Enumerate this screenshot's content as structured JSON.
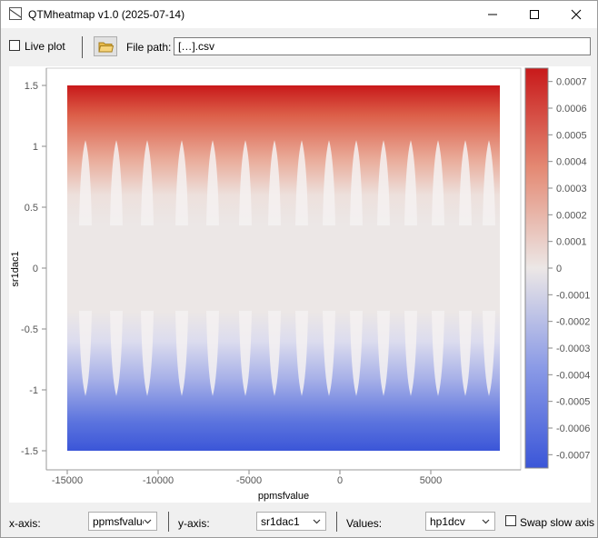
{
  "window": {
    "title": "QTMheatmap v1.0 (2025-07-14)"
  },
  "toolbar": {
    "live_plot_label": "Live plot",
    "live_plot_checked": false,
    "file_path_label": "File path:",
    "file_path_value": "[…].csv",
    "folder_icon": "folder-open-icon"
  },
  "bottombar": {
    "x_axis_label": "x-axis:",
    "x_axis_value": "ppmsfvalue",
    "y_axis_label": "y-axis:",
    "y_axis_value": "sr1dac1",
    "values_label": "Values:",
    "values_value": "hp1dcv",
    "swap_label": "Swap slow axis",
    "swap_checked": false
  },
  "chart_data": {
    "type": "heatmap",
    "title": "",
    "xlabel": "ppmsfvalue",
    "ylabel": "sr1dac1",
    "xlim": [
      -15000,
      8800
    ],
    "ylim": [
      -1.5,
      1.5
    ],
    "xticks": [
      -15000,
      -10000,
      -5000,
      0,
      5000
    ],
    "yticks": [
      1.5,
      1,
      0.5,
      0,
      -0.5,
      -1,
      -1.5
    ],
    "ytick_labels": [
      "1.5",
      "1",
      "0.5",
      "0",
      "-0.5",
      "-1",
      "-1.5"
    ],
    "colorbar": {
      "range": [
        -0.00075,
        0.00075
      ],
      "ticks": [
        0.0007,
        0.0006,
        0.0005,
        0.0004,
        0.0003,
        0.0002,
        0.0001,
        0,
        -0.0001,
        -0.0002,
        -0.0003,
        -0.0004,
        -0.0005,
        -0.0006,
        -0.0007
      ],
      "tick_labels": [
        "0.0007",
        "0.0006",
        "0.0005",
        "0.0004",
        "0.0003",
        "0.0002",
        "0.0001",
        "0",
        "-0.0001",
        "-0.0002",
        "-0.0003",
        "-0.0004",
        "-0.0005",
        "-0.0006",
        "-0.0007"
      ],
      "colormap": "coolwarm",
      "colors": {
        "high": "#c8191a",
        "mid": "#ece7e6",
        "low": "#3b56d8"
      }
    },
    "pattern": {
      "description_values": "value ~0 in |y| < ~0.35; positive toward y=1.5, negative toward y=-1.5",
      "lobe_centers_x": [
        -14000,
        -12300,
        -10600,
        -8700,
        -7000,
        -5200,
        -3600,
        -2100,
        -600,
        900,
        2400,
        3900,
        5400,
        6900,
        8200
      ]
    }
  }
}
